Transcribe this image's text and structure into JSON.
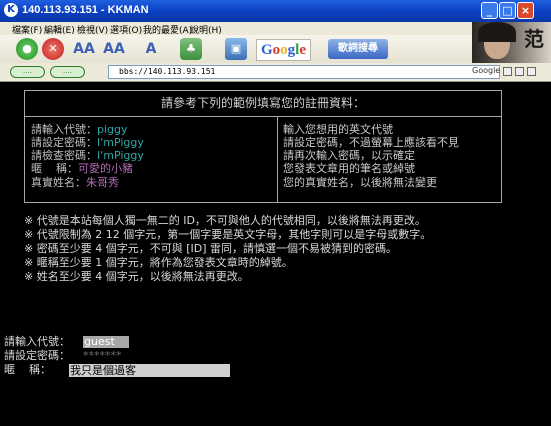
{
  "window": {
    "title": "140.113.93.151 - KKMAN",
    "app_icon": "K",
    "min": "_",
    "max": "□",
    "close": "×"
  },
  "menu": [
    "檔案(F)",
    "編輯(E)",
    "檢視(V)",
    "選項(O)",
    "我的最愛(A)",
    "說明(H)"
  ],
  "toolbar": {
    "go": "●",
    "stop": "✕",
    "font_bigger": "AA",
    "font_smaller": "AA",
    "font_style": "A",
    "tree": "♣",
    "box": "▣",
    "google": [
      "G",
      "o",
      "o",
      "g",
      "l",
      "e"
    ],
    "song_search": "歌詞搜尋"
  },
  "avatar": {
    "char": "范"
  },
  "address": {
    "pill1": "····",
    "pill2": "····",
    "url": "bbs://140.113.93.151",
    "google_label": "Google"
  },
  "terminal": {
    "header": "請參考下列的範例填寫您的註冊資料：",
    "examples": [
      {
        "label": "請輸入代號：",
        "value": "piggy",
        "desc": "輸入您想用的英文代號"
      },
      {
        "label": "請設定密碼：",
        "value": "I'mPiggy",
        "desc": "請設定密碼，不過螢幕上應該看不見"
      },
      {
        "label": "請檢查密碼：",
        "value": "I'mPiggy",
        "desc": "請再次輸入密碼，以示確定"
      },
      {
        "label": "暱    稱：",
        "value": "可愛的小豬",
        "desc": "您發表文章用的筆名或綽號"
      },
      {
        "label": "真實姓名：",
        "value": "朱哥秀",
        "desc": "您的真實姓名，以後將無法變更"
      }
    ],
    "rules": [
      "※ 代號是本站每個人獨一無二的 ID，不可與他人的代號相同，以後將無法再更改。",
      "※ 代號限制為 2 12 個字元，第一個字要是英文字母，其他字則可以是字母或數字。",
      "※ 密碼至少要 4 個字元，不可與 [ID] 雷同，請慎選一個不易被猜到的密碼。",
      "※ 暱稱至少要 1 個字元，將作為您發表文章時的綽號。",
      "※ 姓名至少要 4 個字元，以後將無法再更改。"
    ],
    "prompts": {
      "id_label": "請輸入代號：",
      "id_value": "guest",
      "pass_label": "請設定密碼：",
      "pass_value": "*******",
      "nick_label": "暱    稱：",
      "nick_value": "我只是個過客"
    }
  }
}
